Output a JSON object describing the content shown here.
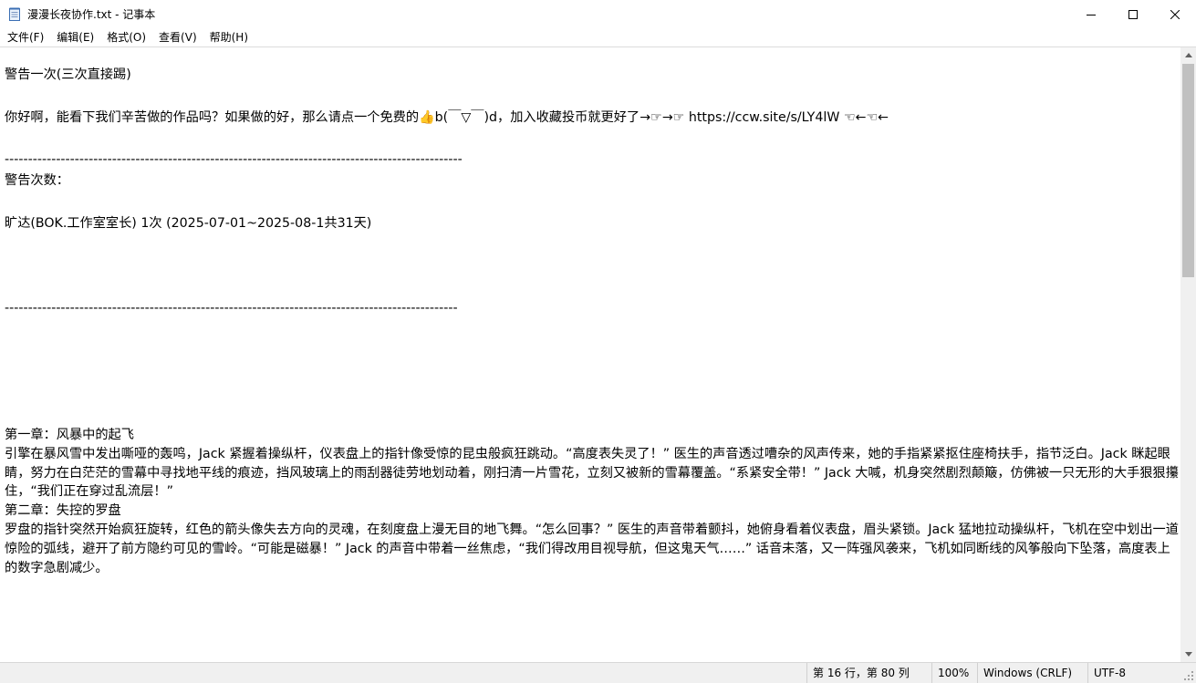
{
  "window": {
    "title": "漫漫长夜协作.txt - 记事本"
  },
  "menu": [
    "文件(F)",
    "编辑(E)",
    "格式(O)",
    "查看(V)",
    "帮助(H)"
  ],
  "editor": {
    "lines": [
      "警告一次(三次直接踢)",
      "",
      "你好啊，能看下我们辛苦做的作品吗？如果做的好，那么请点一个免费的👍b(￣▽￣)d，加入收藏投币就更好了→☞→☞ https://ccw.site/s/LY4lW ☜←☜←",
      "",
      "--------------------------------------------------------------------------------------------------",
      "警告次数：",
      "",
      "旷达(BOK.工作室室长) 1次 (2025-07-01~2025-08-1共31天)",
      "",
      "",
      "",
      "-------------------------------------------------------------------------------------------------",
      "",
      "",
      "",
      "",
      "",
      "第一章：风暴中的起飞",
      "引擎在暴风雪中发出嘶哑的轰鸣，Jack 紧握着操纵杆，仪表盘上的指针像受惊的昆虫般疯狂跳动。“高度表失灵了！” 医生的声音透过嘈杂的风声传来，她的手指紧紧抠住座椅扶手，指节泛白。Jack 眯起眼睛，努力在白茫茫的雪幕中寻找地平线的痕迹，挡风玻璃上的雨刮器徒劳地划动着，刚扫清一片雪花，立刻又被新的雪幕覆盖。“系紧安全带！” Jack 大喊，机身突然剧烈颠簸，仿佛被一只无形的大手狠狠攥住，“我们正在穿过乱流层！”",
      "第二章：失控的罗盘",
      "罗盘的指针突然开始疯狂旋转，红色的箭头像失去方向的灵魂，在刻度盘上漫无目的地飞舞。“怎么回事？” 医生的声音带着颤抖，她俯身看着仪表盘，眉头紧锁。Jack 猛地拉动操纵杆，飞机在空中划出一道惊险的弧线，避开了前方隐约可见的雪岭。“可能是磁暴！” Jack 的声音中带着一丝焦虑，“我们得改用目视导航，但这鬼天气……” 话音未落，又一阵强风袭来，飞机如同断线的风筝般向下坠落，高度表上的数字急剧减少。"
    ]
  },
  "status": {
    "position": "第 16 行，第 80 列",
    "zoom": "100%",
    "line_ending": "Windows (CRLF)",
    "encoding": "UTF-8"
  }
}
